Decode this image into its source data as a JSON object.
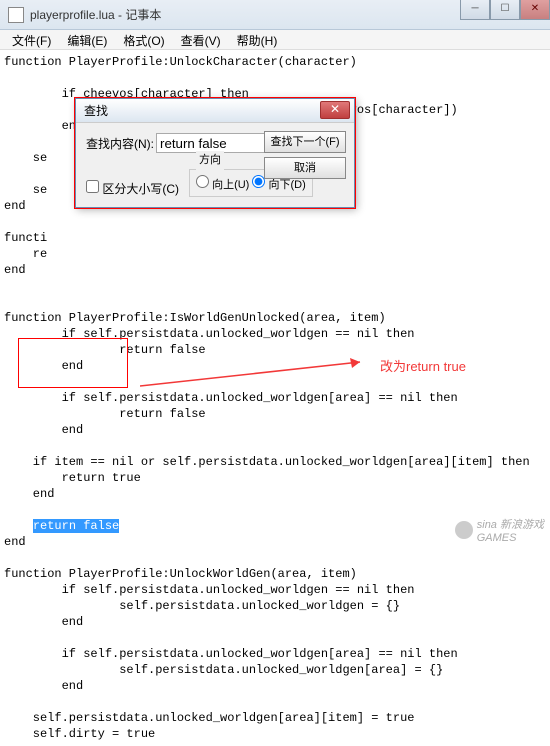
{
  "titlebar": {
    "text": "playerprofile.lua - 记事本"
  },
  "menubar": {
    "file": "文件(F)",
    "edit": "编辑(E)",
    "format": "格式(O)",
    "view": "查看(V)",
    "help": "帮助(H)"
  },
  "code": "function PlayerProfile:UnlockCharacter(character)\n\n        if cheevos[character] then\n            TheGameService:AwardAchievement(cheevos[character])\n        end\n\n    se\n\n    se\nend\n\nfuncti\n    re\nend\n\n\nfunction PlayerProfile:IsWorldGenUnlocked(area, item)\n        if self.persistdata.unlocked_worldgen == nil then\n                return false\n        end\n\n        if self.persistdata.unlocked_worldgen[area] == nil then\n                return false\n        end\n\n    if item == nil or self.persistdata.unlocked_worldgen[area][item] then\n        return true\n    end\n\n    ",
  "highlighted": "return false",
  "code_after": "\nend\n\nfunction PlayerProfile:UnlockWorldGen(area, item)\n        if self.persistdata.unlocked_worldgen == nil then\n                self.persistdata.unlocked_worldgen = {}\n        end\n\n        if self.persistdata.unlocked_worldgen[area] == nil then\n                self.persistdata.unlocked_worldgen[area] = {}\n        end\n\n    self.persistdata.unlocked_worldgen[area][item] = true\n    self.dirty = true",
  "dialog": {
    "title": "查找",
    "label_find": "查找内容(N):",
    "input_value": "return false",
    "btn_findnext": "查找下一个(F)",
    "btn_cancel": "取消",
    "chk_case": "区分大小写(C)",
    "group_direction": "方向",
    "radio_up": "向上(U)",
    "radio_down": "向下(D)"
  },
  "annotation": {
    "text": "改为return true"
  },
  "watermark": {
    "brand1": "sina",
    "brand2": "新浪游戏",
    "brand3": "GAMES"
  },
  "colors": {
    "highlight_bg": "#3399ff",
    "annotation": "#f23838",
    "red_box": "#ff0000"
  }
}
